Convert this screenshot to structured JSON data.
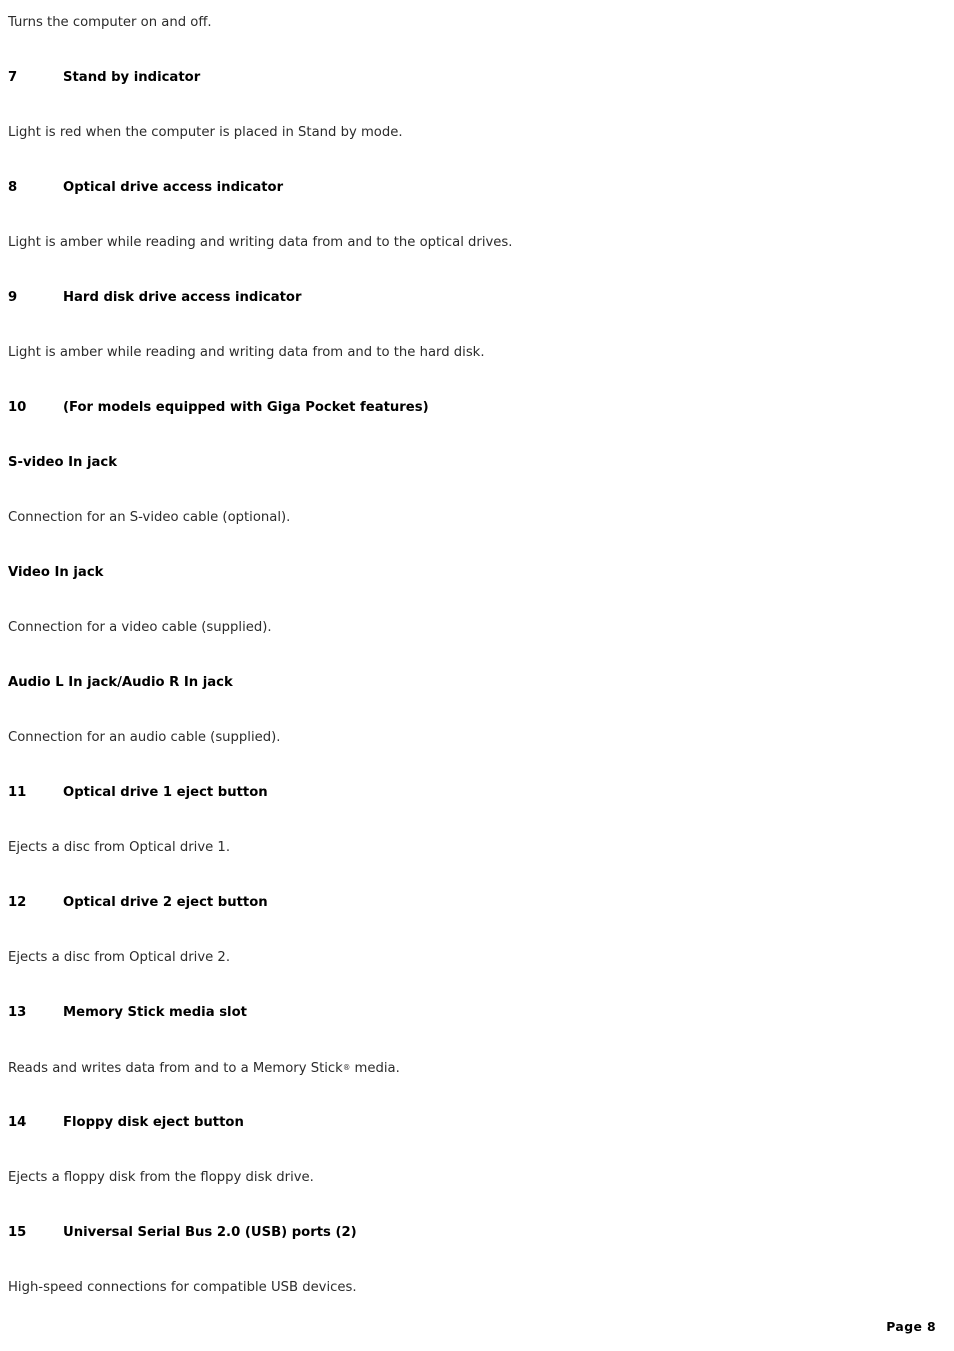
{
  "document": {
    "footer_label": "Page 8",
    "blocks": [
      {
        "kind": "body",
        "text": "Turns the computer on and off."
      },
      {
        "kind": "numbered",
        "number": "7",
        "label": "Stand by indicator"
      },
      {
        "kind": "body",
        "text": "Light is red when the computer is placed in Stand by mode."
      },
      {
        "kind": "numbered",
        "number": "8",
        "label": "Optical drive access indicator"
      },
      {
        "kind": "body",
        "text": "Light is amber while reading and writing data from and to the optical drives."
      },
      {
        "kind": "numbered",
        "number": "9",
        "label": "Hard disk drive access indicator"
      },
      {
        "kind": "body",
        "text": "Light is amber while reading and writing data from and to the hard disk."
      },
      {
        "kind": "numbered",
        "number": "10",
        "label": "(For models equipped with Giga Pocket features)"
      },
      {
        "kind": "subheading",
        "text": "S-video In jack"
      },
      {
        "kind": "body",
        "text": "Connection for an S-video cable (optional)."
      },
      {
        "kind": "subheading",
        "text": "Video In jack"
      },
      {
        "kind": "body",
        "text": "Connection for a video cable (supplied)."
      },
      {
        "kind": "subheading",
        "text": "Audio L In jack/Audio R In jack"
      },
      {
        "kind": "body",
        "text": "Connection for an audio cable (supplied)."
      },
      {
        "kind": "numbered",
        "number": "11",
        "label": "Optical drive 1 eject button"
      },
      {
        "kind": "body",
        "text": "Ejects a disc from Optical drive 1."
      },
      {
        "kind": "numbered",
        "number": "12",
        "label": "Optical drive 2 eject button"
      },
      {
        "kind": "body",
        "text": "Ejects a disc from Optical drive 2."
      },
      {
        "kind": "numbered",
        "number": "13",
        "label": "Memory Stick media slot"
      },
      {
        "kind": "body-trademark",
        "text_before": "Reads and writes data from and to a Memory Stick",
        "trademark": "®",
        "text_after": " media."
      },
      {
        "kind": "numbered",
        "number": "14",
        "label": "Floppy disk eject button"
      },
      {
        "kind": "body",
        "text": "Ejects a floppy disk from the floppy disk drive."
      },
      {
        "kind": "numbered",
        "number": "15",
        "label": "Universal Serial Bus 2.0 (USB) ports (2)"
      },
      {
        "kind": "body",
        "text": "High-speed connections for compatible USB devices."
      }
    ]
  }
}
